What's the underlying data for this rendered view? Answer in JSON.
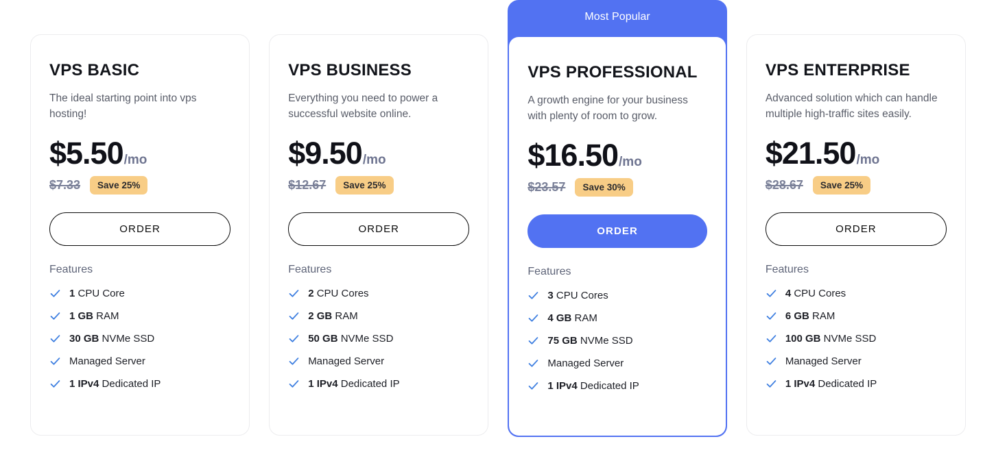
{
  "plans": [
    {
      "name": "VPS BASIC",
      "description": "The ideal starting point into vps hosting!",
      "price": "$5.50",
      "period": "/mo",
      "old_price": "$7.33",
      "save_badge": "Save 25%",
      "order_label": "ORDER",
      "features_label": "Features",
      "popular": false,
      "features": [
        {
          "bold": "1",
          "rest": " CPU Core"
        },
        {
          "bold": "1 GB",
          "rest": " RAM"
        },
        {
          "bold": "30 GB",
          "rest": " NVMe SSD"
        },
        {
          "bold": "",
          "rest": "Managed Server"
        },
        {
          "bold": "1 IPv4",
          "rest": " Dedicated IP"
        }
      ]
    },
    {
      "name": "VPS BUSINESS",
      "description": "Everything you need to power a successful website online.",
      "price": "$9.50",
      "period": "/mo",
      "old_price": "$12.67",
      "save_badge": "Save 25%",
      "order_label": "ORDER",
      "features_label": "Features",
      "popular": false,
      "features": [
        {
          "bold": "2",
          "rest": " CPU Cores"
        },
        {
          "bold": "2 GB",
          "rest": " RAM"
        },
        {
          "bold": "50 GB",
          "rest": " NVMe SSD"
        },
        {
          "bold": "",
          "rest": "Managed Server"
        },
        {
          "bold": "1 IPv4",
          "rest": " Dedicated IP"
        }
      ]
    },
    {
      "name": "VPS PROFESSIONAL",
      "description": "A growth engine for your business with plenty of room to grow.",
      "price": "$16.50",
      "period": "/mo",
      "old_price": "$23.57",
      "save_badge": "Save 30%",
      "order_label": "ORDER",
      "features_label": "Features",
      "popular": true,
      "popular_label": "Most Popular",
      "features": [
        {
          "bold": "3",
          "rest": " CPU Cores"
        },
        {
          "bold": "4 GB",
          "rest": " RAM"
        },
        {
          "bold": "75 GB",
          "rest": " NVMe SSD"
        },
        {
          "bold": "",
          "rest": "Managed Server"
        },
        {
          "bold": "1 IPv4",
          "rest": " Dedicated IP"
        }
      ]
    },
    {
      "name": "VPS ENTERPRISE",
      "description": "Advanced solution which can handle multiple high-traffic sites easily.",
      "price": "$21.50",
      "period": "/mo",
      "old_price": "$28.67",
      "save_badge": "Save 25%",
      "order_label": "ORDER",
      "features_label": "Features",
      "popular": false,
      "features": [
        {
          "bold": "4",
          "rest": " CPU Cores"
        },
        {
          "bold": "6 GB",
          "rest": " RAM"
        },
        {
          "bold": "100 GB",
          "rest": " NVMe SSD"
        },
        {
          "bold": "",
          "rest": "Managed Server"
        },
        {
          "bold": "1 IPv4",
          "rest": " Dedicated IP"
        }
      ]
    }
  ],
  "icons": {
    "check": "check-icon"
  },
  "colors": {
    "accent_blue": "#5272f2",
    "badge_amber": "#f8cd86",
    "muted_text": "#5e6478",
    "old_price": "#7a8098",
    "card_border": "#ececee"
  }
}
